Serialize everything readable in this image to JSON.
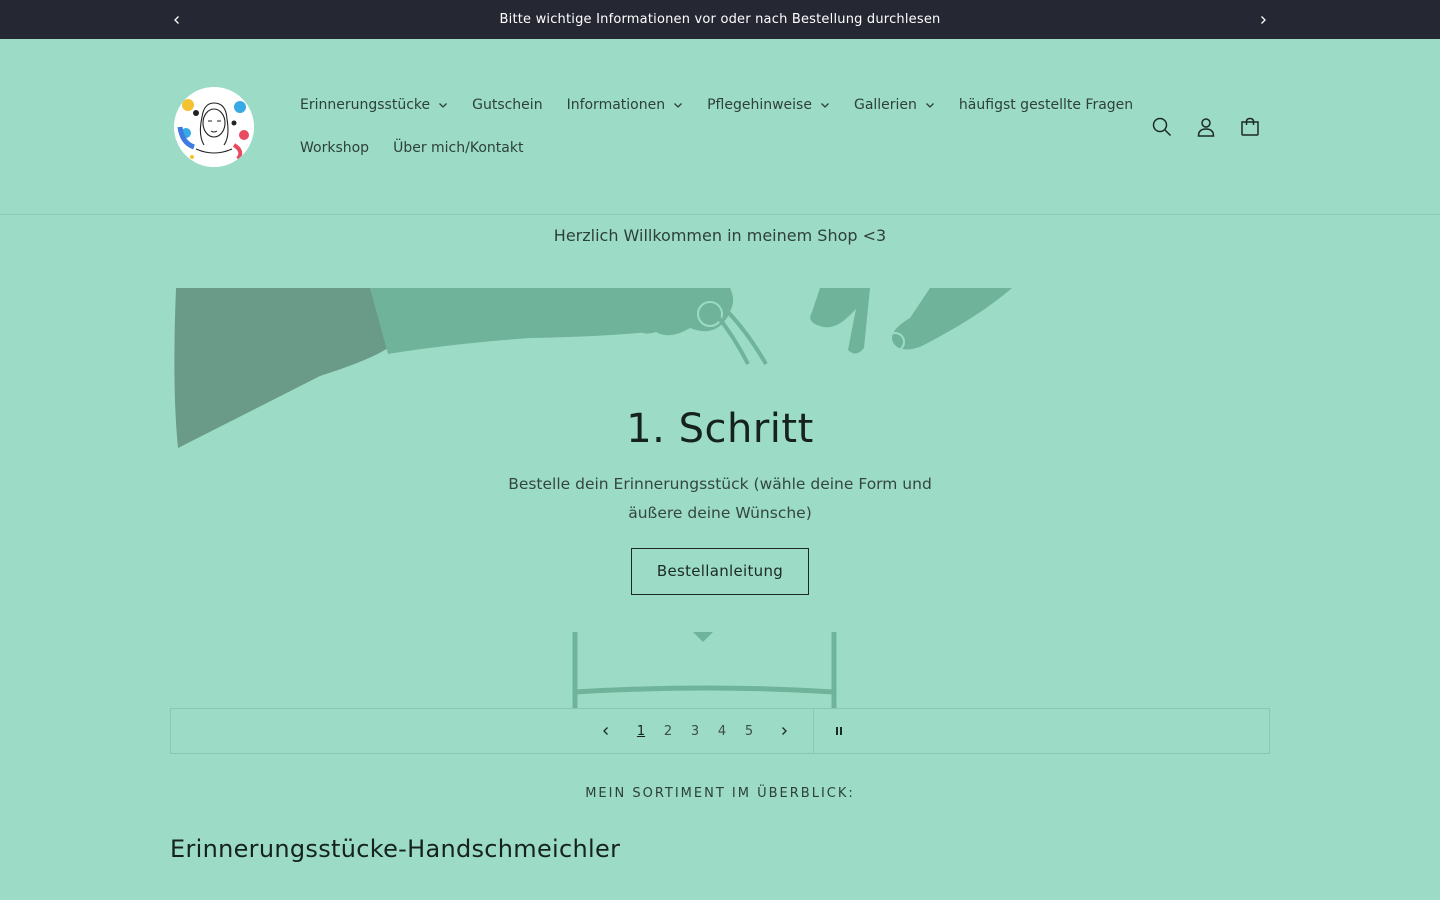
{
  "announcement": {
    "text": "Bitte wichtige Informationen vor oder nach Bestellung durchlesen",
    "prev_icon": "chevron-left-icon",
    "next_icon": "chevron-right-icon"
  },
  "header": {
    "nav_row1": [
      {
        "label": "Erinnerungsstücke",
        "has_dropdown": true
      },
      {
        "label": "Gutschein",
        "has_dropdown": false
      },
      {
        "label": "Informationen",
        "has_dropdown": true
      },
      {
        "label": "Pflegehinweise",
        "has_dropdown": true
      },
      {
        "label": "Gallerien",
        "has_dropdown": true
      },
      {
        "label": "häufigst gestellte Fragen",
        "has_dropdown": false
      }
    ],
    "nav_row2": [
      {
        "label": "Workshop",
        "has_dropdown": false
      },
      {
        "label": "Über mich/Kontakt",
        "has_dropdown": false
      }
    ],
    "icons": [
      "search-icon",
      "account-icon",
      "cart-icon"
    ]
  },
  "welcome": {
    "text": "Herzlich Willkommen in meinem Shop <3"
  },
  "slideshow": {
    "title": "1. Schritt",
    "text": "Bestelle dein Erinnerungsstück (wähle deine Form und äußere deine Wünsche)",
    "button": "Bestellanleitung",
    "dots": [
      "1",
      "2",
      "3",
      "4",
      "5"
    ],
    "current": 1,
    "icons": {
      "prev": "chevron-left-icon",
      "next": "chevron-right-icon",
      "pause": "pause-icon"
    }
  },
  "overview": {
    "label": "MEIN SORTIMENT IM ÜBERBLICK:",
    "heading": "Erinnerungsstücke-Handschmeichler"
  },
  "colors": {
    "background": "#9cdcc6",
    "announcement_bg": "#252733",
    "illustration": "#6fb39b",
    "text": "#1c2a25"
  }
}
